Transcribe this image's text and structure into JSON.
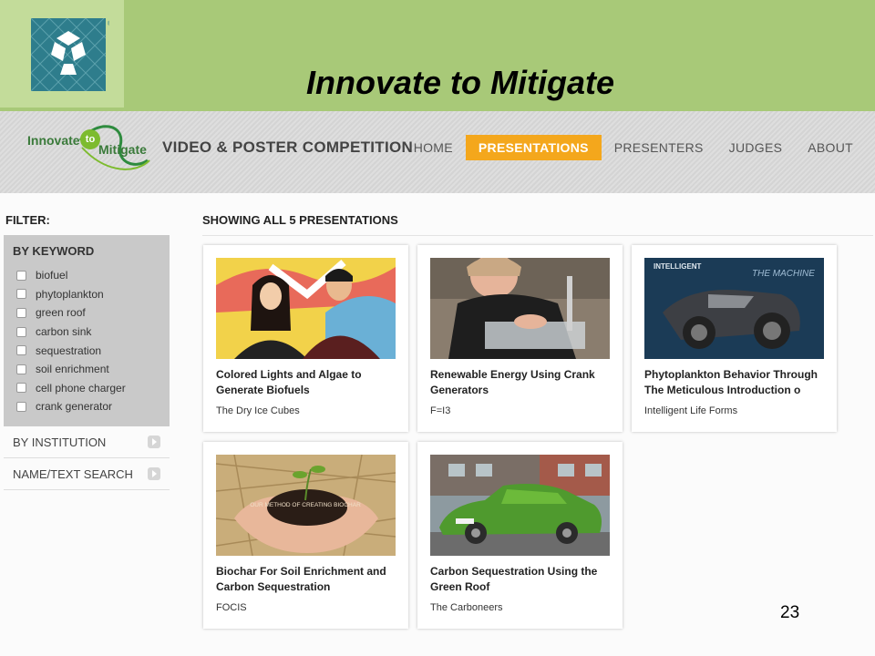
{
  "slide": {
    "title": "Innovate to Mitigate",
    "page_number": "23"
  },
  "brand": {
    "line1": "Innovate",
    "circle": "to",
    "line2": "Mitigate",
    "competition": "VIDEO & POSTER COMPETITION"
  },
  "nav": {
    "items": [
      {
        "label": "HOME",
        "active": false
      },
      {
        "label": "PRESENTATIONS",
        "active": true
      },
      {
        "label": "PRESENTERS",
        "active": false
      },
      {
        "label": "JUDGES",
        "active": false
      },
      {
        "label": "ABOUT",
        "active": false
      }
    ]
  },
  "colors": {
    "header_green": "#a8c978",
    "accent_orange": "#f4a71c"
  },
  "filter": {
    "label": "FILTER:",
    "keyword_title": "BY KEYWORD",
    "keywords": [
      "biofuel",
      "phytoplankton",
      "green roof",
      "carbon sink",
      "sequestration",
      "soil enrichment",
      "cell phone charger",
      "crank generator"
    ],
    "by_institution": "BY INSTITUTION",
    "name_text_search": "NAME/TEXT SEARCH"
  },
  "results": {
    "heading": "SHOWING ALL 5 PRESENTATIONS",
    "cards": [
      {
        "title": "Colored Lights and Algae to Generate Biofuels",
        "team": "The Dry Ice Cubes"
      },
      {
        "title": "Renewable Energy Using Crank Generators",
        "team": "F=I3"
      },
      {
        "title": "Phytoplankton Behavior Through The Meticulous Introduction o",
        "team": "Intelligent Life Forms",
        "thumb_text_1": "INTELLIGENT",
        "thumb_text_2": "THE MACHINE"
      },
      {
        "title": "Biochar For Soil Enrichment and Carbon Sequestration",
        "team": "FOCIS",
        "thumb_caption": "OUR METHOD OF CREATING BIOCHAR"
      },
      {
        "title": "Carbon Sequestration Using the Green Roof",
        "team": "The Carboneers"
      }
    ]
  }
}
